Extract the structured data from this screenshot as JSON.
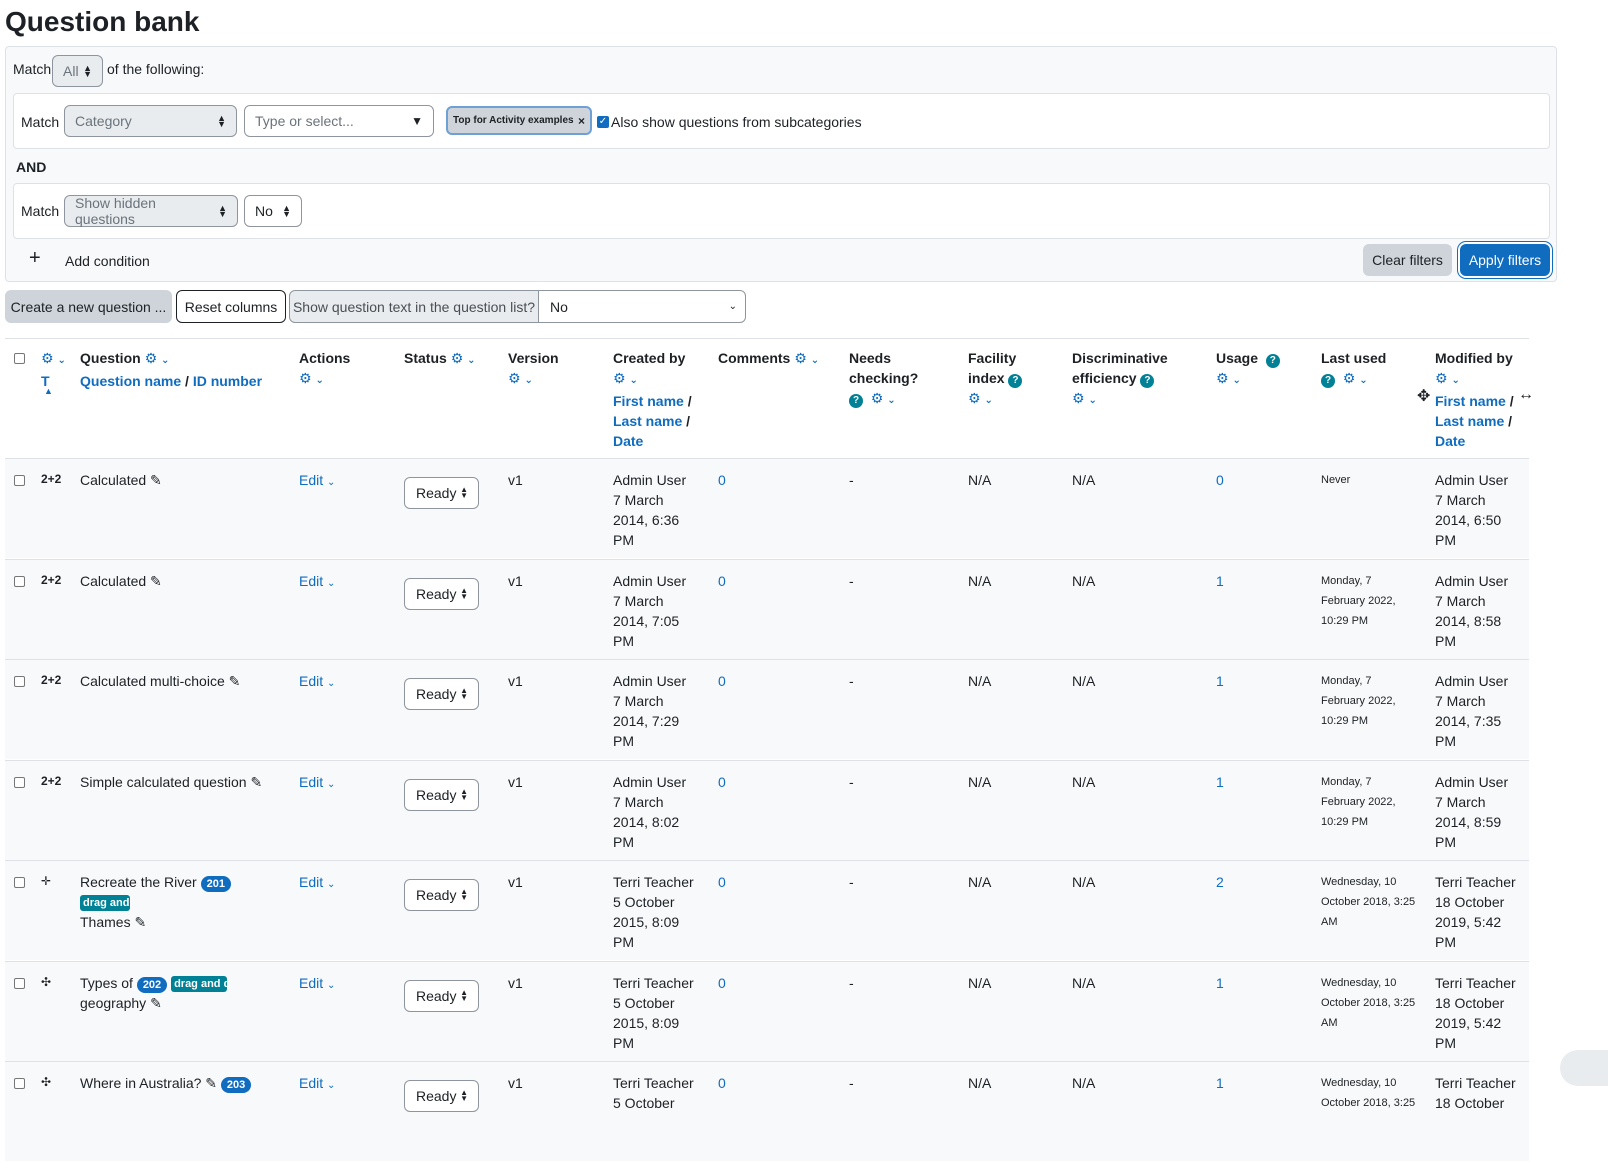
{
  "page": {
    "title": "Question bank"
  },
  "filters": {
    "match_label": "Match",
    "match_value": "All",
    "of_following": "of the following:",
    "cond1": {
      "match_label": "Match",
      "field": "Category",
      "type_placeholder": "Type or select...",
      "chip": "Top for Activity examples",
      "subcat_label": "Also show questions from subcategories"
    },
    "and_label": "AND",
    "cond2": {
      "match_label": "Match",
      "field": "Show hidden questions",
      "value": "No"
    },
    "add_condition": "Add condition",
    "clear_filters": "Clear filters",
    "apply_filters": "Apply filters"
  },
  "toolbar": {
    "create_new": "Create a new question ...",
    "reset_columns": "Reset columns",
    "show_text_label": "Show question text in the question list?",
    "show_text_value": "No"
  },
  "columns": {
    "t": "T",
    "question": "Question",
    "question_name": "Question name",
    "id_number": "ID number",
    "actions": "Actions",
    "status": "Status",
    "version": "Version",
    "created_by": "Created by",
    "first_name": "First name",
    "last_name": "Last name",
    "date": "Date",
    "comments": "Comments",
    "needs_checking_1": "Needs",
    "needs_checking_2": "checking?",
    "facility_1": "Facility",
    "facility_2": "index",
    "disc_1": "Discriminative",
    "disc_2": "efficiency",
    "usage": "Usage",
    "last_used": "Last used",
    "modified_by": "Modified by"
  },
  "rows": [
    {
      "icon": "2+2",
      "name_1": "Calculated",
      "name_2": "",
      "badge_id": "",
      "badge_tag": "",
      "action": "Edit",
      "status": "Ready",
      "version": "v1",
      "created_1": "Admin User",
      "created_2": "7 March",
      "created_3": "2014, 6:36",
      "created_4": "PM",
      "comments": "0",
      "needs": "-",
      "facility": "N/A",
      "disc": "N/A",
      "usage": "0",
      "last_1": "Never",
      "last_2": "",
      "last_3": "",
      "mod_1": "Admin User",
      "mod_2": "7 March",
      "mod_3": "2014, 6:50",
      "mod_4": "PM"
    },
    {
      "icon": "2+2",
      "name_1": "Calculated",
      "name_2": "",
      "badge_id": "",
      "badge_tag": "",
      "action": "Edit",
      "status": "Ready",
      "version": "v1",
      "created_1": "Admin User",
      "created_2": "7 March",
      "created_3": "2014, 7:05",
      "created_4": "PM",
      "comments": "0",
      "needs": "-",
      "facility": "N/A",
      "disc": "N/A",
      "usage": "1",
      "last_1": "Monday, 7",
      "last_2": "February 2022,",
      "last_3": "10:29 PM",
      "mod_1": "Admin User",
      "mod_2": "7 March",
      "mod_3": "2014, 8:58",
      "mod_4": "PM"
    },
    {
      "icon": "2+2",
      "name_1": "Calculated multi-choice",
      "name_2": "",
      "badge_id": "",
      "badge_tag": "",
      "action": "Edit",
      "status": "Ready",
      "version": "v1",
      "created_1": "Admin User",
      "created_2": "7 March",
      "created_3": "2014, 7:29",
      "created_4": "PM",
      "comments": "0",
      "needs": "-",
      "facility": "N/A",
      "disc": "N/A",
      "usage": "1",
      "last_1": "Monday, 7",
      "last_2": "February 2022,",
      "last_3": "10:29 PM",
      "mod_1": "Admin User",
      "mod_2": "7 March",
      "mod_3": "2014, 7:35",
      "mod_4": "PM"
    },
    {
      "icon": "2+2",
      "name_1": "Simple calculated question",
      "name_2": "",
      "badge_id": "",
      "badge_tag": "",
      "action": "Edit",
      "status": "Ready",
      "version": "v1",
      "created_1": "Admin User",
      "created_2": "7 March",
      "created_3": "2014, 8:02",
      "created_4": "PM",
      "comments": "0",
      "needs": "-",
      "facility": "N/A",
      "disc": "N/A",
      "usage": "1",
      "last_1": "Monday, 7",
      "last_2": "February 2022,",
      "last_3": "10:29 PM",
      "mod_1": "Admin User",
      "mod_2": "7 March",
      "mod_3": "2014, 8:59",
      "mod_4": "PM"
    },
    {
      "icon": "✛",
      "name_1": "Recreate the River",
      "name_2": "Thames",
      "badge_id": "201",
      "badge_tag": "drag and",
      "action": "Edit",
      "status": "Ready",
      "version": "v1",
      "created_1": "Terri Teacher",
      "created_2": "5 October",
      "created_3": "2015, 8:09",
      "created_4": "PM",
      "comments": "0",
      "needs": "-",
      "facility": "N/A",
      "disc": "N/A",
      "usage": "2",
      "last_1": "Wednesday, 10",
      "last_2": "October 2018, 3:25",
      "last_3": "AM",
      "mod_1": "Terri Teacher",
      "mod_2": "18 October",
      "mod_3": "2019, 5:42",
      "mod_4": "PM"
    },
    {
      "icon": "✣",
      "name_1": "Types of",
      "name_2": "geography",
      "badge_id": "202",
      "badge_tag": "drag and d",
      "action": "Edit",
      "status": "Ready",
      "version": "v1",
      "created_1": "Terri Teacher",
      "created_2": "5 October",
      "created_3": "2015, 8:09",
      "created_4": "PM",
      "comments": "0",
      "needs": "-",
      "facility": "N/A",
      "disc": "N/A",
      "usage": "1",
      "last_1": "Wednesday, 10",
      "last_2": "October 2018, 3:25",
      "last_3": "AM",
      "mod_1": "Terri Teacher",
      "mod_2": "18 October",
      "mod_3": "2019, 5:42",
      "mod_4": "PM"
    },
    {
      "icon": "✣",
      "name_1": "Where in Australia?",
      "name_2": "",
      "badge_id": "203",
      "badge_tag": "",
      "action": "Edit",
      "status": "Ready",
      "version": "v1",
      "created_1": "Terri Teacher",
      "created_2": "5 October",
      "created_3": "",
      "created_4": "",
      "comments": "0",
      "needs": "-",
      "facility": "N/A",
      "disc": "N/A",
      "usage": "1",
      "last_1": "Wednesday, 10",
      "last_2": "October 2018, 3:25",
      "last_3": "",
      "mod_1": "Terri Teacher",
      "mod_2": "18 October",
      "mod_3": "",
      "mod_4": ""
    }
  ]
}
